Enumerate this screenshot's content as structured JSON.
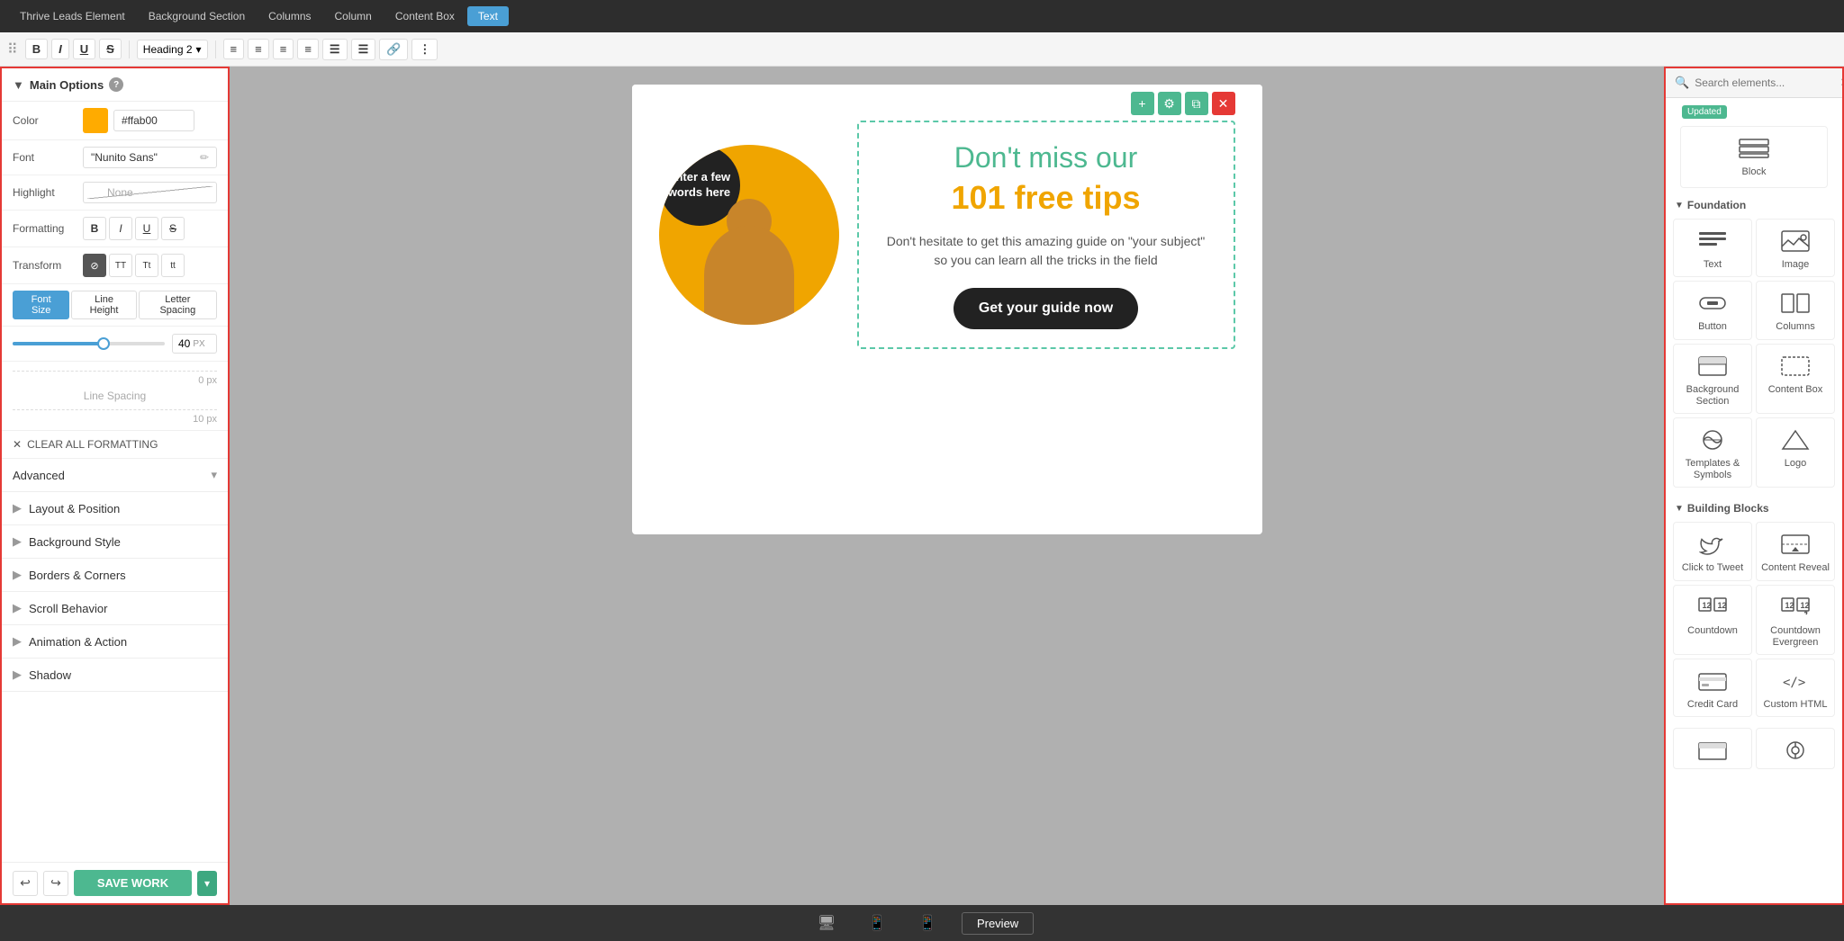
{
  "top_nav": {
    "items": [
      {
        "label": "Thrive Leads Element",
        "active": false
      },
      {
        "label": "Background Section",
        "active": false
      },
      {
        "label": "Columns",
        "active": false
      },
      {
        "label": "Column",
        "active": false
      },
      {
        "label": "Content Box",
        "active": false
      },
      {
        "label": "Text",
        "active": true
      }
    ]
  },
  "toolbar": {
    "heading_select": "Heading 2",
    "buttons": [
      "B",
      "I",
      "U",
      "S"
    ]
  },
  "left_panel": {
    "title": "Main Options",
    "help_label": "?",
    "color_label": "Color",
    "color_value": "#ffab00",
    "font_label": "Font",
    "font_value": "\"Nunito Sans\"",
    "highlight_label": "Highlight",
    "highlight_placeholder": "None",
    "formatting_label": "Formatting",
    "format_buttons": [
      "B",
      "I",
      "U",
      "S"
    ],
    "transform_label": "Transform",
    "transform_buttons": [
      {
        "label": "⊘",
        "active": true
      },
      {
        "label": "TT",
        "active": false
      },
      {
        "label": "Tt",
        "active": false
      },
      {
        "label": "tt",
        "active": false
      }
    ],
    "font_size_tab": "Font Size",
    "line_height_tab": "Line Height",
    "letter_spacing_tab": "Letter Spacing",
    "slider_value": "40",
    "slider_unit": "PX",
    "line_spacing_top": "0 px",
    "line_spacing_label": "Line Spacing",
    "line_spacing_bottom": "10 px",
    "clear_formatting": "CLEAR ALL FORMATTING",
    "advanced_label": "Advanced",
    "sections": [
      "Layout & Position",
      "Background Style",
      "Borders & Corners",
      "Scroll Behavior",
      "Animation & Action",
      "Shadow"
    ]
  },
  "canvas": {
    "circle_text": "Enter a few words here",
    "headline_green": "Don't miss our",
    "headline_orange": "101 free tips",
    "sub_text_line1": "Don't hesitate to get this amazing guide on \"your subject\"",
    "sub_text_line2": "so you can learn all the tricks in the field",
    "cta_button": "Get your guide now",
    "toolbar_btns": [
      "+",
      "⚙",
      "⊞",
      "✕"
    ]
  },
  "bottom_bar": {
    "preview_label": "Preview"
  },
  "right_panel": {
    "search_placeholder": "Search elements...",
    "updated_badge": "Updated",
    "block_label": "Block",
    "foundation_title": "Foundation",
    "foundation_items": [
      {
        "label": "Text",
        "icon": "text"
      },
      {
        "label": "Image",
        "icon": "image"
      },
      {
        "label": "Button",
        "icon": "button"
      },
      {
        "label": "Columns",
        "icon": "columns"
      },
      {
        "label": "Background Section",
        "icon": "bgsection"
      },
      {
        "label": "Content Box",
        "icon": "contentbox"
      },
      {
        "label": "Templates & Symbols",
        "icon": "templates"
      },
      {
        "label": "Logo",
        "icon": "logo"
      }
    ],
    "building_blocks_title": "Building Blocks",
    "building_items": [
      {
        "label": "Click to Tweet",
        "icon": "tweet"
      },
      {
        "label": "Content Reveal",
        "icon": "reveal"
      },
      {
        "label": "Countdown",
        "icon": "countdown"
      },
      {
        "label": "Countdown Evergreen",
        "icon": "countdownevergreen"
      },
      {
        "label": "Credit Card",
        "icon": "creditcard"
      },
      {
        "label": "Custom HTML",
        "icon": "html"
      }
    ]
  },
  "save_footer": {
    "undo_label": "↩",
    "redo_label": "↪",
    "save_label": "SAVE WORK",
    "dropdown_label": "▾"
  }
}
